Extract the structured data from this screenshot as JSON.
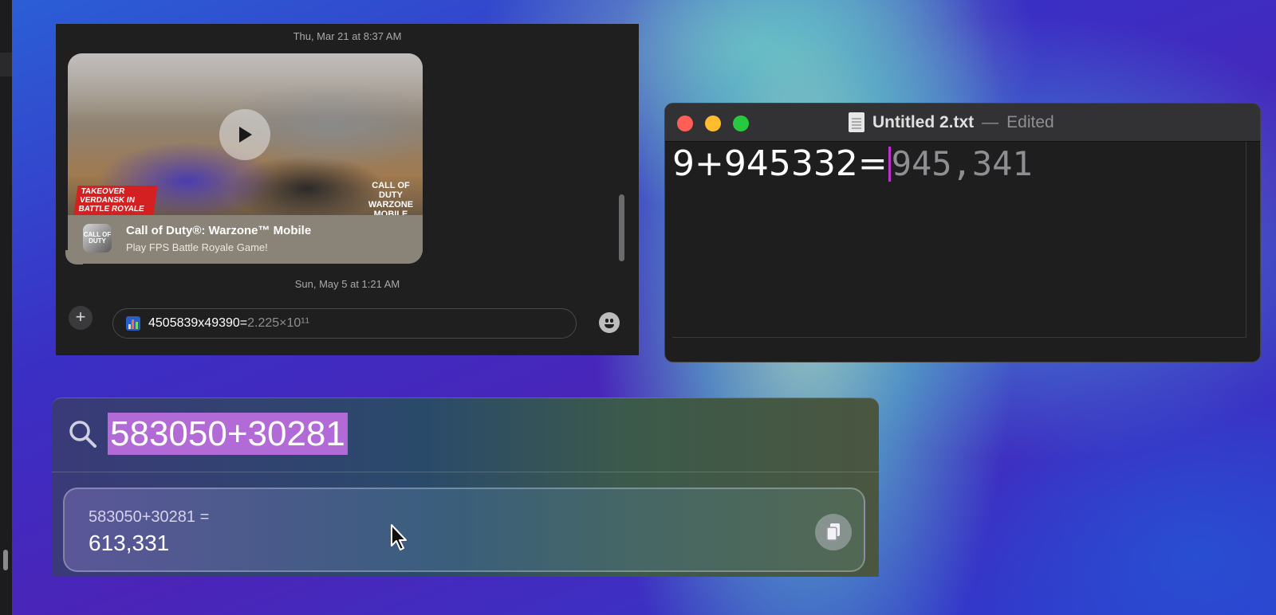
{
  "messages": {
    "timestamp_1": "Thu, Mar 21 at 8:37 AM",
    "link_preview": {
      "badge_left": "TAKEOVER VERDANSK IN BATTLE ROYALE",
      "badge_right": "CALL OF DUTY WARZONE MOBILE",
      "app_icon_text": "CALL OF DUTY",
      "title": "Call of Duty®: Warzone™ Mobile",
      "subtitle": "Play FPS Battle Royale Game!"
    },
    "timestamp_2": "Sun, May 5 at 1:21 AM",
    "compose": {
      "typed": "4505839x49390=",
      "suggestion": "2.225×10¹¹"
    }
  },
  "textedit": {
    "filename": "Untitled 2.txt",
    "separator": "—",
    "status": "Edited",
    "typed": "9+945332=",
    "suggestion": "945,341"
  },
  "spotlight": {
    "query": "583050+30281",
    "result_expression": "583050+30281 =",
    "result_value": "613,331"
  },
  "colors": {
    "highlight": "#b26ad6",
    "caret": "#c02fd0",
    "close": "#ff5f57",
    "minimize": "#febc2e",
    "zoom": "#28c840"
  }
}
